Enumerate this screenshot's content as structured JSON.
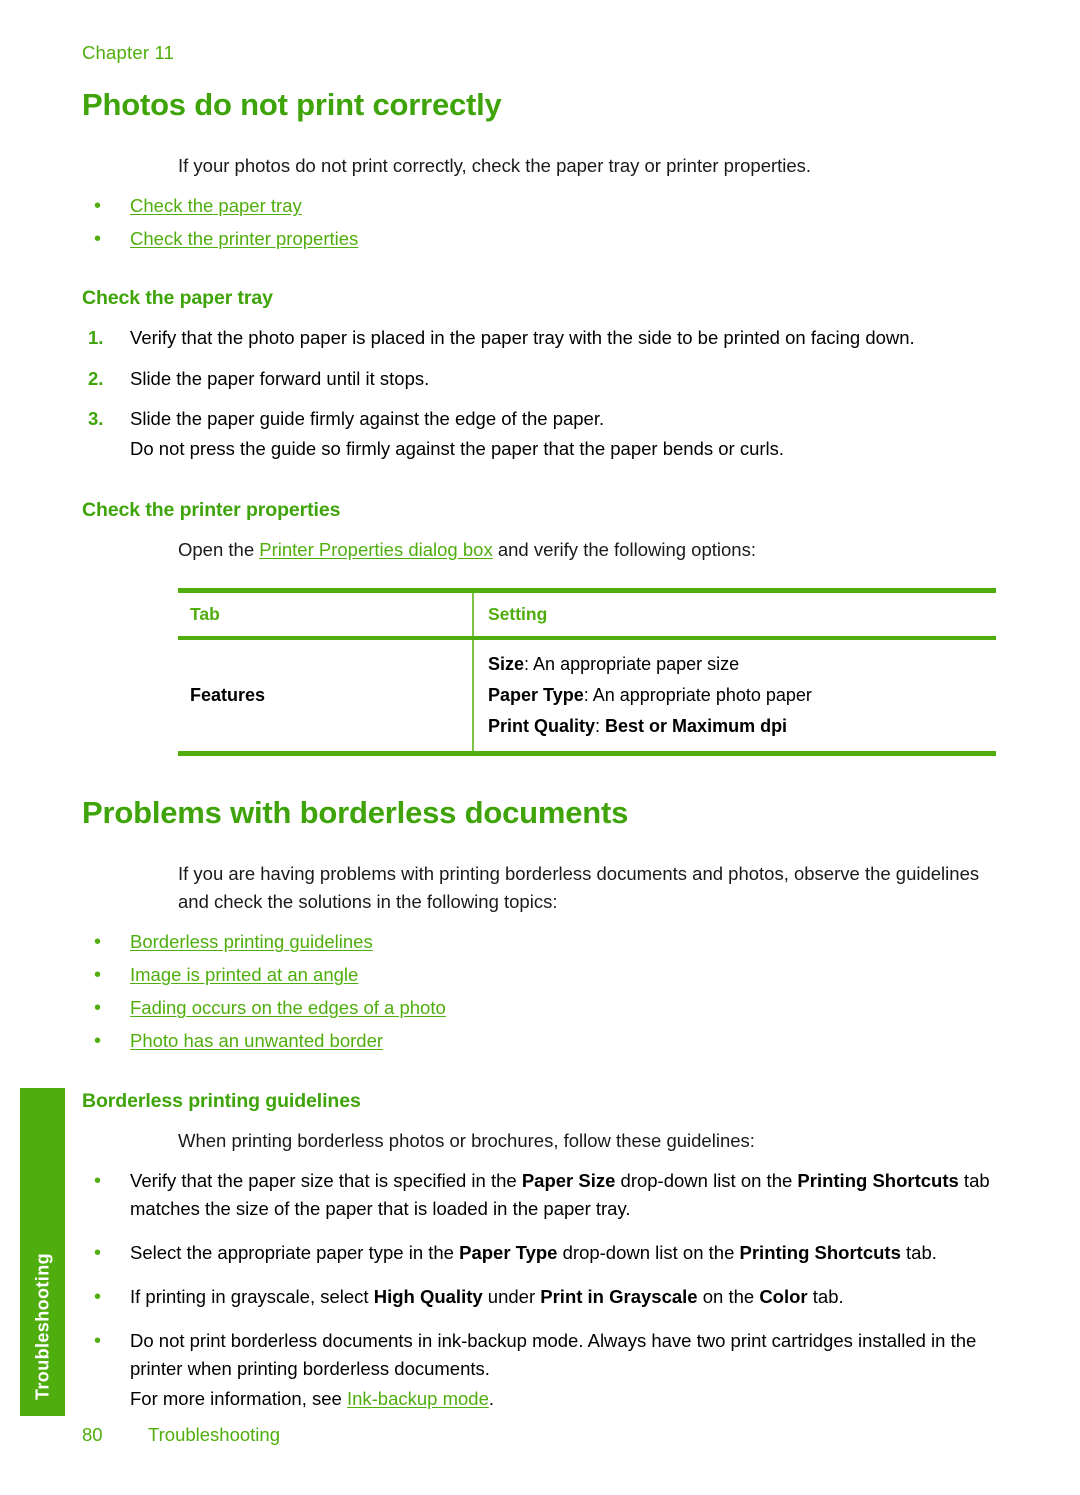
{
  "colors": {
    "accent_green": "#4FAE0D",
    "heading_green": "#3FA40A",
    "text_black": "#1a1a1a"
  },
  "header": {
    "chapter_label": "Chapter 11"
  },
  "sections": [
    {
      "title": "Photos do not print correctly",
      "intro": "If your photos do not print correctly, check the paper tray or printer properties.",
      "links": [
        "Check the paper tray",
        "Check the printer properties"
      ]
    }
  ],
  "subsection_paper_tray": {
    "title": "Check the paper tray",
    "steps": [
      {
        "num": "1.",
        "text": "Verify that the photo paper is placed in the paper tray with the side to be printed on facing down."
      },
      {
        "num": "2.",
        "text": "Slide the paper forward until it stops."
      },
      {
        "num": "3.",
        "text": "Slide the paper guide firmly against the edge of the paper.",
        "sub": "Do not press the guide so firmly against the paper that the paper bends or curls."
      }
    ]
  },
  "subsection_printer_properties": {
    "title": "Check the printer properties",
    "intro_before": "Open the ",
    "intro_link": "Printer Properties dialog box",
    "intro_after": " and verify the following options:",
    "table": {
      "headers": [
        "Tab",
        "Setting"
      ],
      "rows": [
        {
          "tab": "Features",
          "settings": [
            {
              "label": "Size",
              "sep": ": ",
              "value": "An appropriate paper size",
              "value_bold": false
            },
            {
              "label": "Paper Type",
              "sep": ": ",
              "value": "An appropriate photo paper",
              "value_bold": false
            },
            {
              "label": "Print Quality",
              "sep": ": ",
              "value": "Best or Maximum dpi",
              "value_bold": true
            }
          ]
        }
      ]
    }
  },
  "section_borderless": {
    "title": "Problems with borderless documents",
    "intro": "If you are having problems with printing borderless documents and photos, observe the guidelines and check the solutions in the following topics:",
    "links": [
      "Borderless printing guidelines",
      "Image is printed at an angle",
      "Fading occurs on the edges of a photo",
      "Photo has an unwanted border"
    ]
  },
  "subsection_guidelines": {
    "title": "Borderless printing guidelines",
    "intro": "When printing borderless photos or brochures, follow these guidelines:",
    "bullets": [
      "Verify that the paper size that is specified in the <b>Paper Size</b> drop-down list on the <b>Printing Shortcuts</b> tab matches the size of the paper that is loaded in the paper tray.",
      "Select the appropriate paper type in the <b>Paper Type</b> drop-down list on the <b>Printing Shortcuts</b> tab.",
      "If printing in grayscale, select <b>High Quality</b> under <b>Print in Grayscale</b> on the <b>Color</b> tab.",
      "Do not print borderless documents in ink-backup mode. Always have two print cartridges installed in the printer when printing borderless documents.<span class=\"sub-line\">For more information, see <span class=\"doclink\">Ink-backup mode</span>.</span>"
    ]
  },
  "side_tab": {
    "label": "Troubleshooting"
  },
  "footer": {
    "page_number": "80",
    "section_name": "Troubleshooting"
  }
}
